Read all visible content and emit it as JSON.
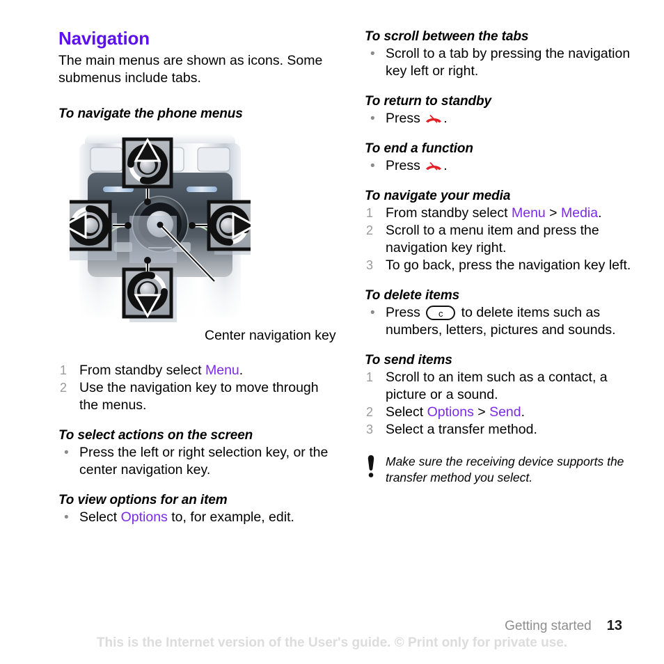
{
  "document": {
    "section_title": "Navigation",
    "intro": "The main menus are shown as icons. Some submenus include tabs."
  },
  "left_column": {
    "figure": {
      "heading": "To navigate the phone menus",
      "caption": "Center navigation key",
      "alt_name": "phone-navigation-key-diagram"
    },
    "procedure_navigate_menus": {
      "steps": [
        {
          "num": "1",
          "pre": "From standby select ",
          "link": "Menu",
          "post": "."
        },
        {
          "num": "2",
          "pre": "Use the navigation key to move through the menus.",
          "link": "",
          "post": ""
        }
      ]
    },
    "procedure_select_actions": {
      "heading": "To select actions on the screen",
      "bullets": [
        "Press the left or right selection key, or the center navigation key."
      ]
    },
    "procedure_view_options": {
      "heading": "To view options for an item",
      "bullet_pre": "Select ",
      "bullet_link": "Options",
      "bullet_post": " to, for example, edit."
    }
  },
  "right_column": {
    "procedure_scroll_tabs": {
      "heading": "To scroll between the tabs",
      "bullets": [
        "Scroll to a tab by pressing the navigation key left or right."
      ]
    },
    "procedure_return_standby": {
      "heading": "To return to standby",
      "bullet_pre": "Press ",
      "icon": "end-call-icon",
      "bullet_post": "."
    },
    "procedure_end_function": {
      "heading": "To end a function",
      "bullet_pre": "Press ",
      "icon": "end-call-icon",
      "bullet_post": "."
    },
    "procedure_navigate_media": {
      "heading": "To navigate your media",
      "steps": [
        {
          "num": "1",
          "pre": "From standby select ",
          "link1": "Menu",
          "sep": " > ",
          "link2": "Media",
          "post": "."
        },
        {
          "num": "2",
          "text": "Scroll to a menu item and press the navigation key right."
        },
        {
          "num": "3",
          "text": "To go back, press the navigation key left."
        }
      ]
    },
    "procedure_delete_items": {
      "heading": "To delete items",
      "bullet_pre": "Press ",
      "key_label": "c",
      "bullet_post": " to delete items such as numbers, letters, pictures and sounds."
    },
    "procedure_send_items": {
      "heading": "To send items",
      "steps": [
        {
          "num": "1",
          "text": "Scroll to an item such as a contact, a picture or a sound."
        },
        {
          "num": "2",
          "pre": "Select ",
          "link1": "Options",
          "sep": " > ",
          "link2": "Send",
          "post": "."
        },
        {
          "num": "3",
          "text": "Select a transfer method."
        }
      ]
    },
    "note": {
      "icon": "exclamation-icon",
      "text": "Make sure the receiving device supports the transfer method you select."
    }
  },
  "footer": {
    "chapter": "Getting started",
    "page_number": "13",
    "disclaimer": "This is the Internet version of the User's guide. © Print only for private use."
  },
  "colors": {
    "heading_purple": "#5b10ec",
    "link_purple": "#7b2ae8",
    "step_number_gray": "#9a9a9a",
    "footer_gray": "#8e8e8e",
    "disclaimer_gray": "#dcdcdc",
    "end_call_red": "#e31f26"
  }
}
